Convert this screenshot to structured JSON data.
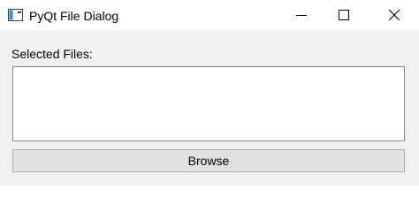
{
  "window": {
    "title": "PyQt File Dialog",
    "app_icon": "window-icon",
    "controls": {
      "minimize_icon": "minimize-icon",
      "maximize_icon": "maximize-icon",
      "close_icon": "close-icon"
    }
  },
  "main": {
    "files_label": "Selected Files:",
    "file_list_items": [],
    "browse_label": "Browse"
  },
  "colors": {
    "titlebar_bg": "#ffffff",
    "client_bg": "#f0f0f0",
    "button_bg": "#e1e1e1",
    "list_border": "#828790"
  }
}
